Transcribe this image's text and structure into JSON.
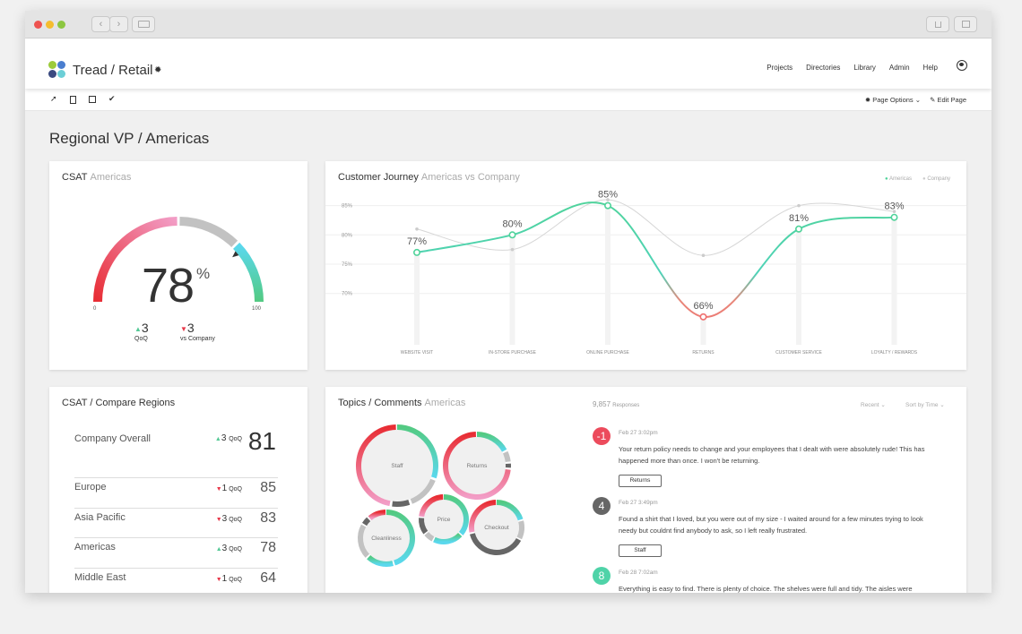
{
  "browser": {
    "traffic_lights": [
      "#ee5350",
      "#f5bd2f",
      "#8cc640"
    ],
    "back_icon": "‹",
    "forward_icon": "›"
  },
  "header": {
    "brand": "Tread / Retail",
    "logo_colors": [
      "#9ccb3b",
      "#4a7ecf",
      "#3b4a80",
      "#6ccfd7"
    ],
    "nav": [
      "Projects",
      "Directories",
      "Library",
      "Admin",
      "Help"
    ]
  },
  "toolbar": {
    "page_options": "Page Options",
    "edit_page": "Edit Page"
  },
  "page_title": "Regional VP  /  Americas",
  "csat": {
    "title": "CSAT",
    "subtitle": "Americas",
    "value": "78",
    "percent": "%",
    "scale_min": "0",
    "scale_max": "100",
    "value_num": 78,
    "qoq": {
      "direction": "up",
      "value": "3",
      "label": "QoQ"
    },
    "vs_company": {
      "direction": "down",
      "value": "3",
      "label": "vs Company"
    }
  },
  "journey": {
    "title": "Customer Journey",
    "subtitle": "Americas vs Company",
    "legend": [
      "Americas",
      "Company"
    ]
  },
  "chart_data": {
    "type": "line",
    "title": "Customer Journey",
    "subtitle": "Americas vs Company",
    "categories": [
      "WEBSITE VISIT",
      "IN-STORE PURCHASE",
      "ONLINE PURCHASE",
      "RETURNS",
      "CUSTOMER SERVICE",
      "LOYALTY / REWARDS"
    ],
    "series": [
      {
        "name": "Americas",
        "values": [
          77,
          80,
          85,
          66,
          81,
          83
        ],
        "labels": [
          "77%",
          "80%",
          "85%",
          "66%",
          "81%",
          "83%"
        ],
        "color": "#4fd39a"
      },
      {
        "name": "Company",
        "values": [
          81,
          77.5,
          86,
          76.5,
          85,
          84
        ],
        "color": "#cccccc"
      }
    ],
    "yticks": [
      "85%",
      "80%",
      "75%",
      "70%"
    ],
    "ytick_values": [
      85,
      80,
      75,
      70
    ],
    "ylim": [
      62,
      88
    ],
    "grid": true,
    "legend_position": "top-right",
    "xlabel": "",
    "ylabel": ""
  },
  "regions": {
    "title": "CSAT  /  Compare Regions",
    "qoq_label": "QoQ",
    "overall": {
      "name": "Company Overall",
      "direction": "up",
      "delta": "3",
      "value": "81"
    },
    "rows": [
      {
        "name": "Europe",
        "direction": "down",
        "delta": "1",
        "value": "85"
      },
      {
        "name": "Asia Pacific",
        "direction": "down",
        "delta": "3",
        "value": "83"
      },
      {
        "name": "Americas",
        "direction": "up",
        "delta": "3",
        "value": "78"
      },
      {
        "name": "Middle East",
        "direction": "down",
        "delta": "1",
        "value": "64"
      }
    ]
  },
  "topics": {
    "title": "Topics / Comments",
    "subtitle": "Americas",
    "bubbles": [
      {
        "label": "Staff"
      },
      {
        "label": "Returns"
      },
      {
        "label": "Price"
      },
      {
        "label": "Checkout"
      },
      {
        "label": "Cleanliness"
      }
    ],
    "responses_count": "9,857",
    "responses_label": "Responses",
    "filter_recent": "Recent",
    "filter_sort": "Sort by Time",
    "comments": [
      {
        "score": "-1",
        "color": "#ec4b5c",
        "date": "Feb 27   3:02pm",
        "text": "Your return policy needs to change and your employees that I dealt with were absolutely rude!  This has happened more than once.  I won't be returning.",
        "tag": "Returns"
      },
      {
        "score": "4",
        "color": "#666666",
        "date": "Feb 27   3:49pm",
        "text": "Found a shirt that I loved, but you were out of my size - I waited around for a few minutes trying to look needy but couldnt find anybody to ask, so I left really frustrated.",
        "tag": "Staff"
      },
      {
        "score": "8",
        "color": "#4fd3a8",
        "date": "Feb 28   7:02am",
        "text": "Everything is easy to find. There is plenty of choice. The shelves were full and tidy. The aisles were"
      }
    ]
  }
}
